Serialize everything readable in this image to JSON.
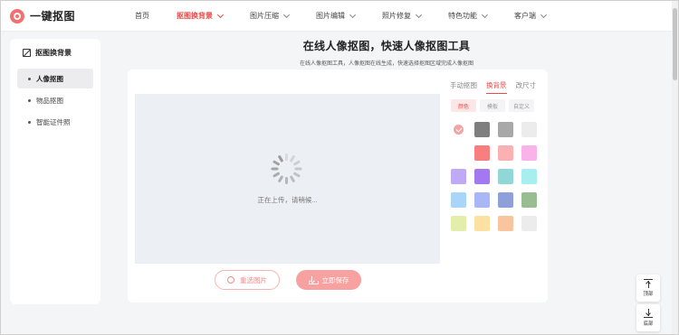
{
  "brand": {
    "name": "一键抠图",
    "logo_color": "#f46f6f"
  },
  "nav": [
    {
      "label": "首页",
      "has_dropdown": false,
      "active": false
    },
    {
      "label": "抠图换背景",
      "has_dropdown": true,
      "active": true
    },
    {
      "label": "图片压缩",
      "has_dropdown": true,
      "active": false
    },
    {
      "label": "图片编辑",
      "has_dropdown": true,
      "active": false
    },
    {
      "label": "照片修复",
      "has_dropdown": true,
      "active": false
    },
    {
      "label": "特色功能",
      "has_dropdown": true,
      "active": false
    },
    {
      "label": "客户端",
      "has_dropdown": true,
      "active": false
    }
  ],
  "sidebar": {
    "title": "抠图换背景",
    "items": [
      {
        "label": "人像抠图",
        "active": true
      },
      {
        "label": "物品抠图",
        "active": false
      },
      {
        "label": "智能证件照",
        "active": false
      }
    ]
  },
  "headline": {
    "title": "在线人像抠图，快速人像抠图工具",
    "subtitle": "在线人像抠图工具，人像抠图在线生成，快速选择抠图区域完成人像抠图"
  },
  "canvas": {
    "loading_text": "正在上传，请稍候..."
  },
  "buttons": {
    "reselect": "重选图片",
    "save": "立即保存"
  },
  "tabs": [
    {
      "label": "手动抠图",
      "active": false
    },
    {
      "label": "换背景",
      "active": true
    },
    {
      "label": "改尺寸",
      "active": false
    }
  ],
  "subtabs": [
    {
      "label": "颜色",
      "active": true
    },
    {
      "label": "模板",
      "active": false
    },
    {
      "label": "自定义",
      "active": false
    }
  ],
  "swatches": [
    {
      "color": "#ffffff",
      "selected": true
    },
    {
      "color": "#7f7f7f",
      "selected": false
    },
    {
      "color": "#a8a8a8",
      "selected": false
    },
    {
      "color": "#ececec",
      "selected": false
    },
    {
      "color": "#ffffff",
      "selected": false
    },
    {
      "color": "#f97e7e",
      "selected": false
    },
    {
      "color": "#fbb1b1",
      "selected": false
    },
    {
      "color": "#f9b3ea",
      "selected": false
    },
    {
      "color": "#c0a9f5",
      "selected": false
    },
    {
      "color": "#a379ef",
      "selected": false
    },
    {
      "color": "#92d7d8",
      "selected": false
    },
    {
      "color": "#a6eef0",
      "selected": false
    },
    {
      "color": "#a9d6f8",
      "selected": false
    },
    {
      "color": "#a9b7f7",
      "selected": false
    },
    {
      "color": "#8da0da",
      "selected": false
    },
    {
      "color": "#97bd91",
      "selected": false
    },
    {
      "color": "#e3eeaa",
      "selected": false
    },
    {
      "color": "#fde1a3",
      "selected": false
    },
    {
      "color": "#f8c59f",
      "selected": false
    },
    {
      "color": "#ececec",
      "selected": false
    }
  ],
  "float": {
    "top_label": "顶部",
    "bottom_label": "底部"
  },
  "colors": {
    "accent": "#e94b4b",
    "canvas_bg": "#eceff3",
    "page_bg": "#f4f5f7"
  }
}
